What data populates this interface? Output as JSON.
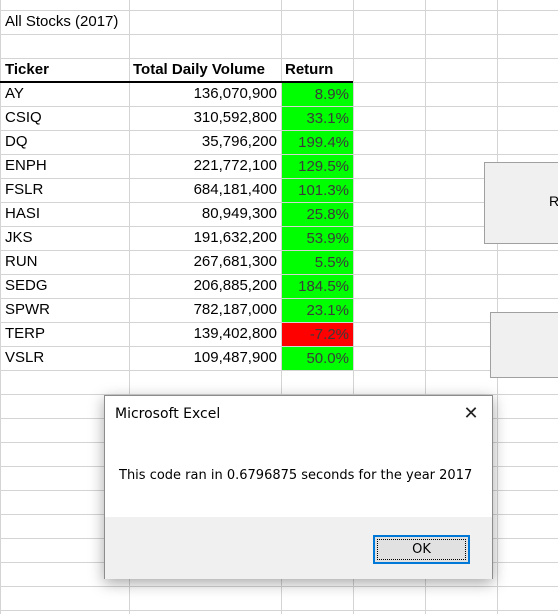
{
  "sheet": {
    "title": "All Stocks (2017)",
    "headers": {
      "ticker": "Ticker",
      "volume": "Total Daily Volume",
      "return": "Return"
    },
    "rows": [
      {
        "ticker": "AY",
        "volume": "136,070,900",
        "return": "8.9%",
        "positive": true
      },
      {
        "ticker": "CSIQ",
        "volume": "310,592,800",
        "return": "33.1%",
        "positive": true
      },
      {
        "ticker": "DQ",
        "volume": "35,796,200",
        "return": "199.4%",
        "positive": true
      },
      {
        "ticker": "ENPH",
        "volume": "221,772,100",
        "return": "129.5%",
        "positive": true
      },
      {
        "ticker": "FSLR",
        "volume": "684,181,400",
        "return": "101.3%",
        "positive": true
      },
      {
        "ticker": "HASI",
        "volume": "80,949,300",
        "return": "25.8%",
        "positive": true
      },
      {
        "ticker": "JKS",
        "volume": "191,632,200",
        "return": "53.9%",
        "positive": true
      },
      {
        "ticker": "RUN",
        "volume": "267,681,300",
        "return": "5.5%",
        "positive": true
      },
      {
        "ticker": "SEDG",
        "volume": "206,885,200",
        "return": "184.5%",
        "positive": true
      },
      {
        "ticker": "SPWR",
        "volume": "782,187,000",
        "return": "23.1%",
        "positive": true
      },
      {
        "ticker": "TERP",
        "volume": "139,402,800",
        "return": "-7.2%",
        "positive": false
      },
      {
        "ticker": "VSLR",
        "volume": "109,487,900",
        "return": "50.0%",
        "positive": true
      }
    ],
    "colors": {
      "positive": "#00ff00",
      "negative": "#ff0000"
    }
  },
  "side_button": {
    "label": "R"
  },
  "dialog": {
    "title": "Microsoft Excel",
    "message": "This code ran in 0.6796875 seconds for the year 2017",
    "ok_label": "OK",
    "close_icon": "close-icon"
  }
}
